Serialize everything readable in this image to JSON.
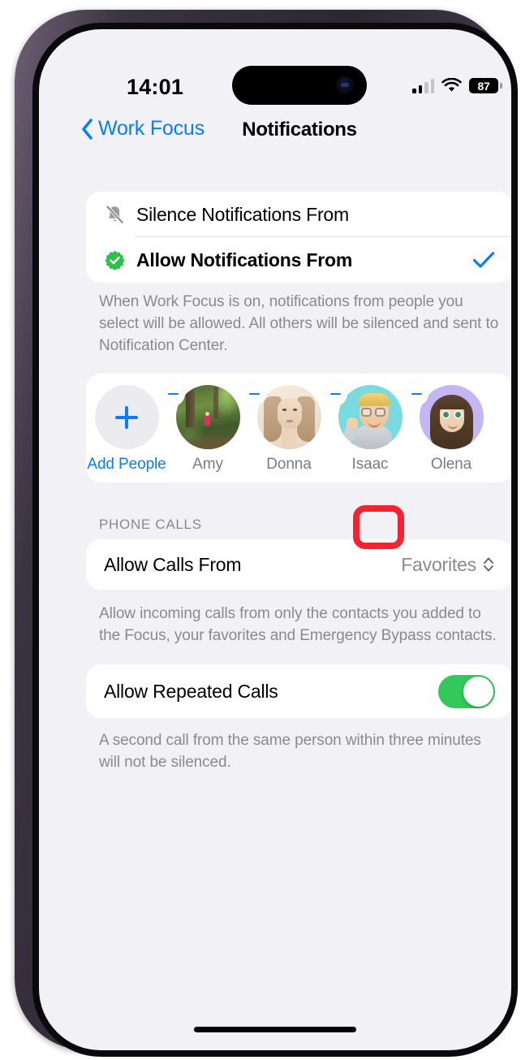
{
  "status_bar": {
    "time": "14:01",
    "battery_level": "87",
    "signal_icon": "cellular-bars-icon",
    "wifi_icon": "wifi-icon",
    "battery_icon": "battery-icon"
  },
  "nav": {
    "back_label": "Work Focus",
    "back_icon": "chevron-left-icon",
    "title": "Notifications"
  },
  "notification_mode": {
    "options": [
      {
        "label": "Silence Notifications From",
        "icon": "bell-slash-icon",
        "selected": false
      },
      {
        "label": "Allow Notifications From",
        "icon": "checkmark-seal-icon",
        "selected": true
      }
    ],
    "footnote": "When Work Focus is on, notifications from people you select will be allowed. All others will be silenced and sent to Notification Center."
  },
  "people": {
    "add_label": "Add People",
    "add_icon": "plus-icon",
    "remove_icon": "minus-badge-icon",
    "list": [
      {
        "name": "Amy",
        "avatar": "photo-forest"
      },
      {
        "name": "Donna",
        "avatar": "photo-portrait"
      },
      {
        "name": "Isaac",
        "avatar": "memoji-blond-glasses"
      },
      {
        "name": "Olena",
        "avatar": "memoji-brunette"
      }
    ]
  },
  "phone_calls": {
    "section_header": "PHONE CALLS",
    "allow_calls": {
      "label": "Allow Calls From",
      "value": "Favorites",
      "icon": "up-down-chevron-icon"
    },
    "allow_calls_footnote": "Allow incoming calls from only the contacts you added to the Focus, your favorites and Emergency Bypass contacts.",
    "repeated_calls": {
      "label": "Allow Repeated Calls",
      "state": "on"
    },
    "repeated_calls_footnote": "A second call from the same person within three minutes will not be silenced."
  },
  "annotation": {
    "highlight_target": "remove-person-isaac",
    "color": "#f5232f"
  },
  "colors": {
    "accent_blue": "#0a7cff",
    "toggle_green": "#34c759",
    "seal_green": "#2ec04a",
    "background": "#f2f1f6",
    "card": "#ffffff",
    "secondary_text": "#8a8a8e"
  }
}
